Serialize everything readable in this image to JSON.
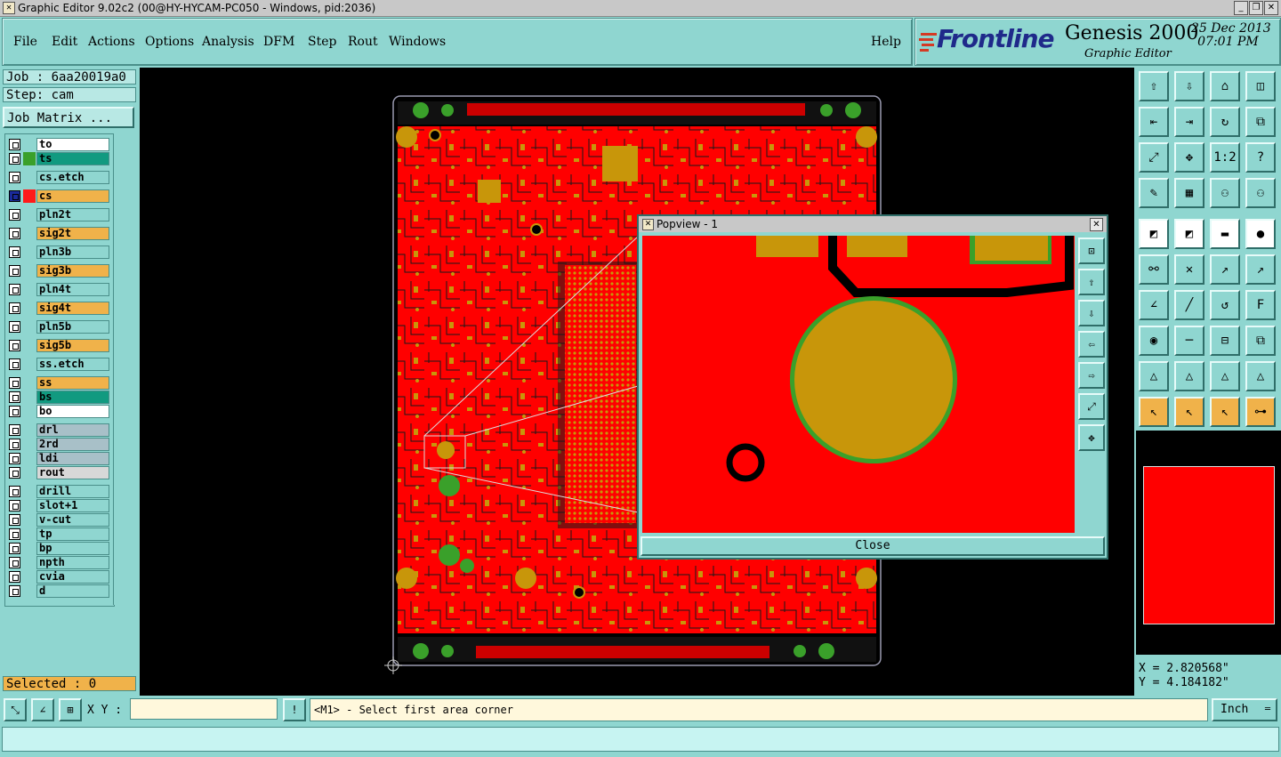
{
  "window": {
    "title": "Graphic Editor 9.02c2 (00@HY-HYCAM-PC050 - Windows, pid:2036)",
    "controls": [
      "_",
      "❐",
      "✕"
    ]
  },
  "menubar": {
    "items": [
      "File",
      "Edit",
      "Actions",
      "Options",
      "Analysis",
      "DFM",
      "Step",
      "Rout",
      "Windows"
    ],
    "help": "Help"
  },
  "brand": {
    "logo": "Frontline",
    "product": "Genesis 2000",
    "module": "Graphic Editor",
    "date": "25 Dec 2013",
    "time": "07:01 PM"
  },
  "job": {
    "job_label": "Job : 6aa20019a0",
    "step_label": "Step: cam",
    "matrix_button": "Job Matrix ..."
  },
  "layers": [
    {
      "name": "to",
      "color": "#ffffff",
      "swatch": "#ffffff"
    },
    {
      "name": "ts",
      "color": "#119a80",
      "swatch": "#3aa02a"
    },
    {
      "name": "cs.etch",
      "color": "#8fd6d0",
      "swatch": "#ffffff"
    },
    {
      "name": "cs",
      "color": "#f0b24a",
      "swatch": "#ff1a1a",
      "active": true
    },
    {
      "name": "pln2t",
      "color": "#8fd6d0",
      "swatch": "#ffffff"
    },
    {
      "name": "sig2t",
      "color": "#f0b24a",
      "swatch": "#ffffff"
    },
    {
      "name": "pln3b",
      "color": "#8fd6d0",
      "swatch": "#ffffff"
    },
    {
      "name": "sig3b",
      "color": "#f0b24a",
      "swatch": "#ffffff"
    },
    {
      "name": "pln4t",
      "color": "#8fd6d0",
      "swatch": "#ffffff"
    },
    {
      "name": "sig4t",
      "color": "#f0b24a",
      "swatch": "#ffffff"
    },
    {
      "name": "pln5b",
      "color": "#8fd6d0",
      "swatch": "#ffffff"
    },
    {
      "name": "sig5b",
      "color": "#f0b24a",
      "swatch": "#ffffff"
    },
    {
      "name": "ss.etch",
      "color": "#8fd6d0",
      "swatch": "#ffffff"
    },
    {
      "name": "ss",
      "color": "#f0b24a",
      "swatch": "#ffffff"
    },
    {
      "name": "bs",
      "color": "#119a80",
      "swatch": "#ffffff"
    },
    {
      "name": "bo",
      "color": "#ffffff",
      "swatch": "#ffffff"
    },
    {
      "name": "drl",
      "color": "#a8c0c8",
      "swatch": "#ffffff"
    },
    {
      "name": "2rd",
      "color": "#a8c0c8",
      "swatch": "#ffffff"
    },
    {
      "name": "ldi",
      "color": "#a8c0c8",
      "swatch": "#ffffff"
    },
    {
      "name": "rout",
      "color": "#d8d8d8",
      "swatch": "#ffffff"
    },
    {
      "name": "drill",
      "color": "#8fd6d0",
      "swatch": "#ffffff"
    },
    {
      "name": "slot+1",
      "color": "#8fd6d0",
      "swatch": "#ffffff"
    },
    {
      "name": "v-cut",
      "color": "#8fd6d0",
      "swatch": "#ffffff"
    },
    {
      "name": "tp",
      "color": "#8fd6d0",
      "swatch": "#ffffff"
    },
    {
      "name": "bp",
      "color": "#8fd6d0",
      "swatch": "#ffffff"
    },
    {
      "name": "npth",
      "color": "#8fd6d0",
      "swatch": "#ffffff"
    },
    {
      "name": "cvia",
      "color": "#8fd6d0",
      "swatch": "#ffffff"
    },
    {
      "name": "d",
      "color": "#8fd6d0",
      "swatch": "#ffffff"
    }
  ],
  "selected": "Selected : 0",
  "popview": {
    "title": "Popview - 1",
    "close": "Close"
  },
  "tools": [
    "open-layer-icon",
    "save-icon",
    "home-icon",
    "split-view-icon",
    "prev-icon",
    "next-icon",
    "rotate-icon",
    "snap-icon",
    "fit-icon",
    "center-icon",
    "scale-1-2-icon",
    "help-icon",
    "measure-tool-icon",
    "grid-icon",
    "components-icon",
    "components-alt-icon",
    "select-icon",
    "polyline-icon",
    "ruler-icon",
    "pad-icon",
    "connect-icon",
    "cross-icon",
    "move-point-icon",
    "arc-point-icon",
    "angle-icon",
    "line-icon",
    "arc-icon",
    "text-icon",
    "snap-point-icon",
    "trim-icon",
    "dimension-icon",
    "copy-icon",
    "triangle-icon",
    "triangle-a-icon",
    "triangle-b-icon",
    "triangle-c-icon",
    "pointer-icon",
    "pointer-box-icon",
    "pointer-active-icon",
    "route-icon"
  ],
  "scale_label": "1:2",
  "coords": {
    "x": "X = 2.820568\"",
    "y": "Y = 4.184182\""
  },
  "bottom": {
    "xy_label": "X Y :",
    "xy_value": "",
    "exclaim": "!",
    "prompt": "<M1> - Select first area corner",
    "units": "Inch"
  },
  "colors": {
    "panel": "#8fd6d0",
    "copper": "#ff0000",
    "pad": "#c8960a",
    "via": "#3aa02a"
  }
}
